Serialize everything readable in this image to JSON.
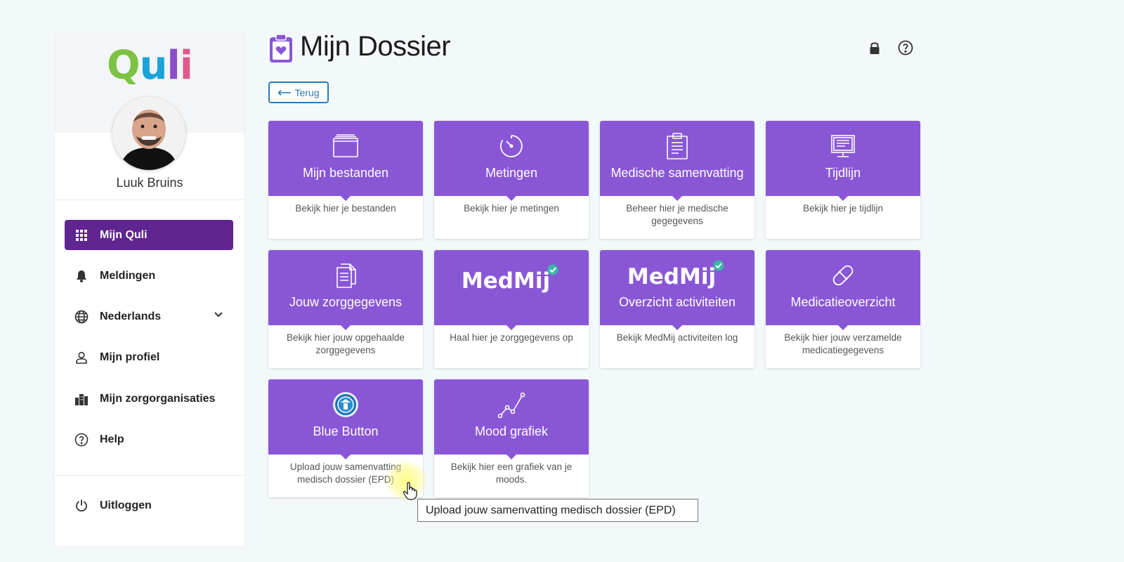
{
  "app": {
    "logo_text": "Quli",
    "user_name": "Luuk Bruins"
  },
  "sidebar": {
    "items": [
      {
        "label": "Mijn Quli",
        "icon": "grid-icon",
        "active": true
      },
      {
        "label": "Meldingen",
        "icon": "bell-icon"
      },
      {
        "label": "Nederlands",
        "icon": "globe-icon",
        "dropdown": true
      },
      {
        "label": "Mijn profiel",
        "icon": "user-icon"
      },
      {
        "label": "Mijn zorgorganisaties",
        "icon": "buildings-icon"
      },
      {
        "label": "Help",
        "icon": "help-circle-icon"
      }
    ],
    "logout_label": "Uitloggen"
  },
  "header": {
    "title": "Mijn Dossier",
    "back_label": "Terug"
  },
  "tiles": [
    {
      "title": "Mijn bestanden",
      "desc": "Bekijk hier je bestanden",
      "icon": "folder-icon"
    },
    {
      "title": "Metingen",
      "desc": "Bekijk hier je metingen",
      "icon": "gauge-icon"
    },
    {
      "title": "Medische samenvatting",
      "desc": "Beheer hier je medische gegegevens",
      "icon": "clipboard-icon"
    },
    {
      "title": "Tijdlijn",
      "desc": "Bekijk hier je tijdlijn",
      "icon": "presentation-icon"
    },
    {
      "title": "Jouw zorggegevens",
      "desc": "Bekijk hier jouw opgehaalde zorggegevens",
      "icon": "documents-icon"
    },
    {
      "title": "",
      "desc": "Haal hier je zorggegevens op",
      "icon": "medmij-logo",
      "logo_text": "MedMij"
    },
    {
      "title": "Overzicht activiteiten",
      "desc": "Bekijk MedMij activiteiten log",
      "icon": "medmij-logo",
      "logo_text": "MedMij"
    },
    {
      "title": "Medicatieoverzicht",
      "desc": "Bekijk hier jouw verzamelde medicatiegegevens",
      "icon": "pill-icon"
    },
    {
      "title": "Blue Button",
      "desc": "Upload jouw samenvatting medisch dossier (EPD)",
      "icon": "blue-button-icon"
    },
    {
      "title": "Mood grafiek",
      "desc": "Bekijk hier een grafiek van je moods.",
      "icon": "line-chart-icon"
    }
  ],
  "tooltip": "Upload jouw samenvatting medisch dossier (EPD)",
  "colors": {
    "tile_purple": "#8957d6",
    "nav_active": "#5f2590",
    "back_button": "#2a7ab8",
    "background": "#f3f9fa"
  }
}
